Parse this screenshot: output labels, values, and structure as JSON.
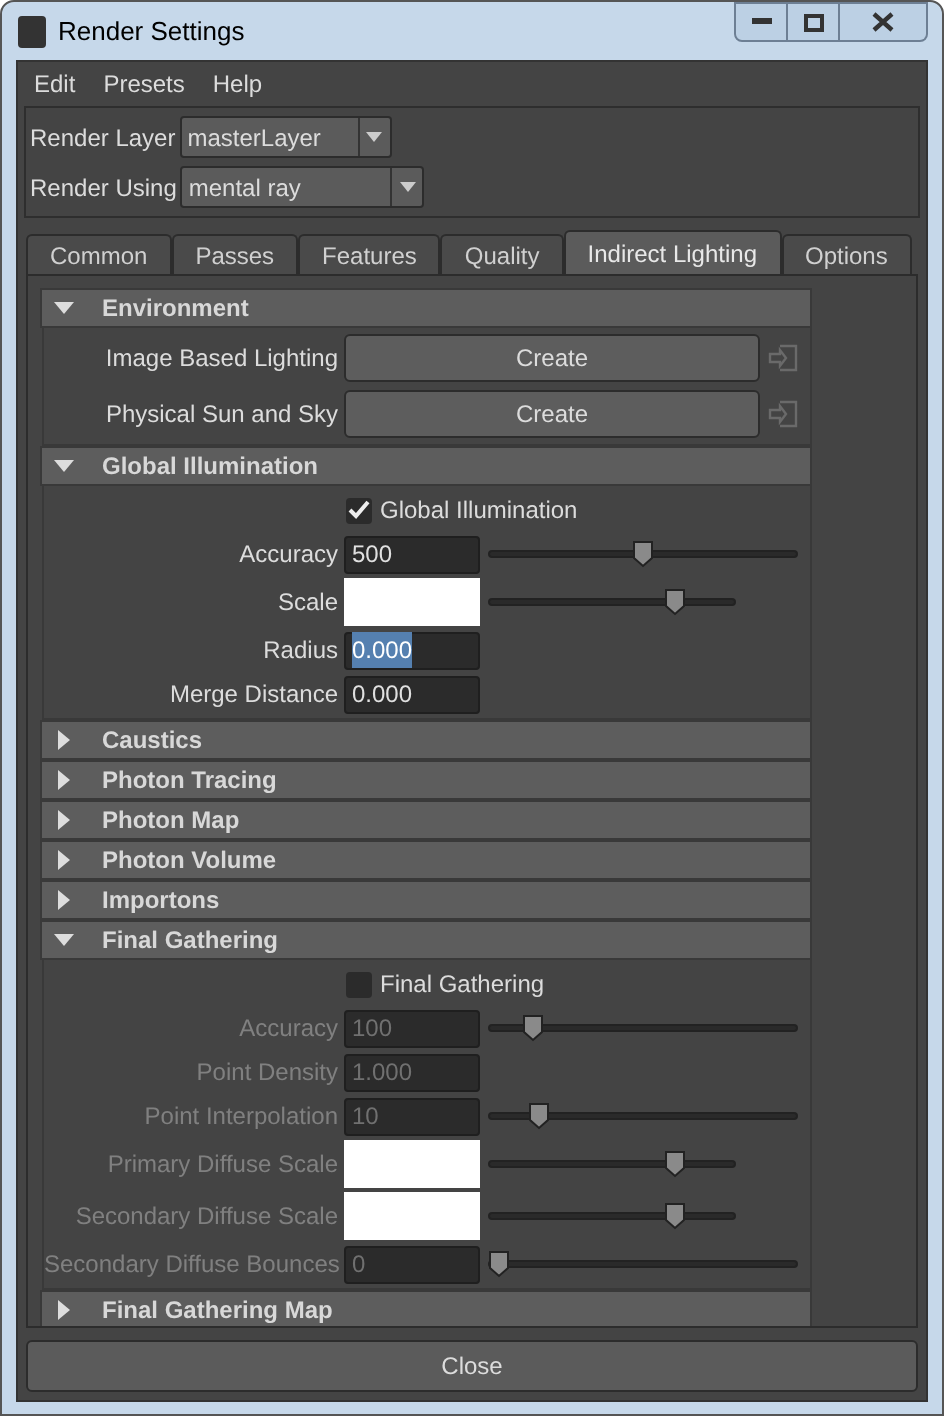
{
  "window": {
    "title": "Render Settings"
  },
  "menu": [
    "Edit",
    "Presets",
    "Help"
  ],
  "render_layer": {
    "label": "Render Layer",
    "value": "masterLayer"
  },
  "render_using": {
    "label": "Render Using",
    "value": "mental ray"
  },
  "tabs": [
    {
      "label": "Common",
      "selected": false
    },
    {
      "label": "Passes",
      "selected": false
    },
    {
      "label": "Features",
      "selected": false
    },
    {
      "label": "Quality",
      "selected": false
    },
    {
      "label": "Indirect Lighting",
      "selected": true
    },
    {
      "label": "Options",
      "selected": false
    }
  ],
  "sections": [
    {
      "title": "Environment",
      "expanded": true,
      "rows": [
        {
          "kind": "button",
          "label": "Image Based Lighting",
          "value": "Create",
          "disabled": false
        },
        {
          "kind": "button",
          "label": "Physical Sun and Sky",
          "value": "Create",
          "disabled": false
        }
      ]
    },
    {
      "title": "Global Illumination",
      "expanded": true,
      "checkbox": {
        "label": "Global Illumination",
        "checked": true
      },
      "rows": [
        {
          "kind": "number",
          "label": "Accuracy",
          "value": "500",
          "level": 0.5,
          "disabled": false,
          "text_selected": false
        },
        {
          "kind": "color",
          "label": "Scale",
          "level": 0.78,
          "disabled": false
        },
        {
          "kind": "number",
          "label": "Radius",
          "value": "0.000",
          "disabled": false,
          "text_selected": true
        },
        {
          "kind": "number",
          "label": "Merge Distance",
          "value": "0.000",
          "disabled": false,
          "text_selected": false
        }
      ]
    },
    {
      "title": "Caustics",
      "expanded": false
    },
    {
      "title": "Photon Tracing",
      "expanded": false
    },
    {
      "title": "Photon Map",
      "expanded": false
    },
    {
      "title": "Photon Volume",
      "expanded": false
    },
    {
      "title": "Importons",
      "expanded": false
    },
    {
      "title": "Final Gathering",
      "expanded": true,
      "checkbox": {
        "label": "Final Gathering",
        "checked": false
      },
      "rows": [
        {
          "kind": "number",
          "label": "Accuracy",
          "value": "100",
          "level": 0.12,
          "disabled": true,
          "text_selected": false
        },
        {
          "kind": "number",
          "label": "Point Density",
          "value": "1.000",
          "disabled": true,
          "text_selected": false
        },
        {
          "kind": "number",
          "label": "Point Interpolation",
          "value": "10",
          "level": 0.14,
          "disabled": true,
          "text_selected": false
        },
        {
          "kind": "color",
          "label": "Primary Diffuse Scale",
          "level": 0.78,
          "disabled": true
        },
        {
          "kind": "color",
          "label": "Secondary Diffuse Scale",
          "level": 0.78,
          "disabled": true
        },
        {
          "kind": "number",
          "label": "Secondary Diffuse Bounces",
          "value": "0",
          "level": 0,
          "disabled": true,
          "text_selected": false
        }
      ]
    },
    {
      "title": "Final Gathering Map",
      "expanded": false
    }
  ],
  "close_button": "Close"
}
